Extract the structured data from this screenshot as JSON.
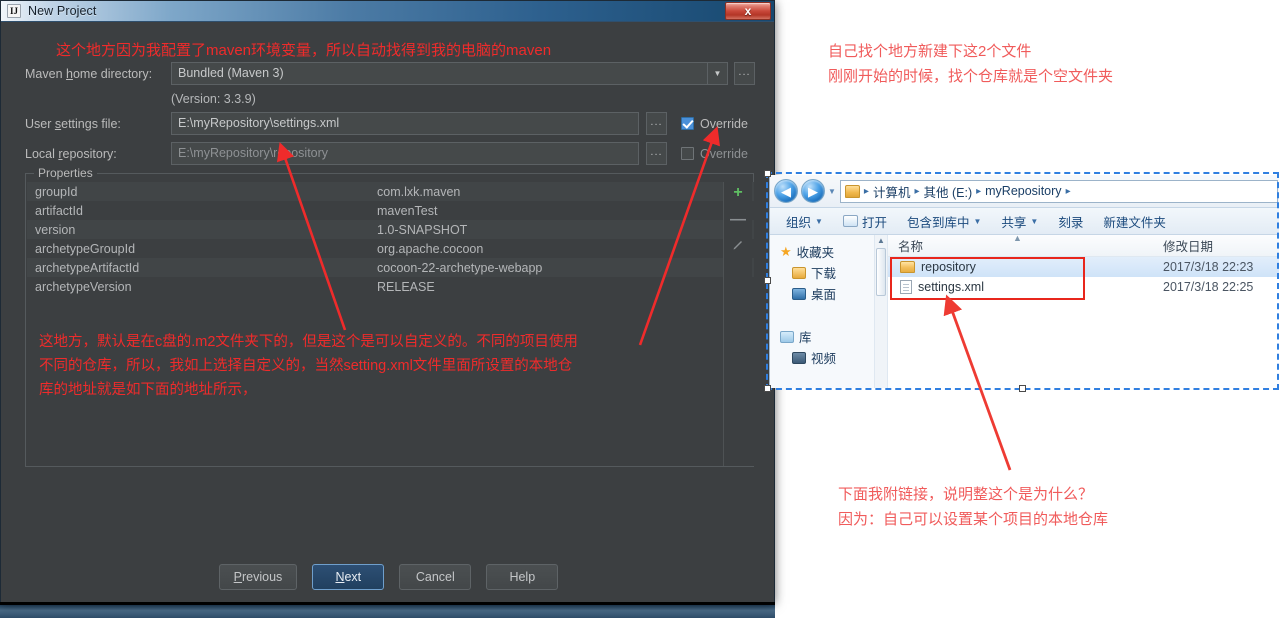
{
  "dialog": {
    "title": "New Project",
    "icon": "intellij-idea-icon",
    "close_label": "x",
    "fields": {
      "maven_home_label_pre": "Maven ",
      "maven_home_label_mnem": "h",
      "maven_home_label_post": "ome directory:",
      "maven_home_value": "Bundled (Maven 3)",
      "version_note": "(Version: 3.3.9)",
      "user_settings_label_pre": "User ",
      "user_settings_label_mnem": "s",
      "user_settings_label_post": "ettings file:",
      "user_settings_value": "E:\\myRepository\\settings.xml",
      "local_repo_label_pre": "Local ",
      "local_repo_label_mnem": "r",
      "local_repo_label_post": "epository:",
      "local_repo_value": "E:\\myRepository\\repository",
      "override_label": "Override",
      "override_settings_checked": true,
      "override_repo_checked": false,
      "browse_label": "..."
    },
    "properties": {
      "legend": "Properties",
      "rows": [
        {
          "key": "groupId",
          "value": "com.lxk.maven"
        },
        {
          "key": "artifactId",
          "value": "mavenTest"
        },
        {
          "key": "version",
          "value": "1.0-SNAPSHOT"
        },
        {
          "key": "archetypeGroupId",
          "value": "org.apache.cocoon"
        },
        {
          "key": "archetypeArtifactId",
          "value": "cocoon-22-archetype-webapp"
        },
        {
          "key": "archetypeVersion",
          "value": "RELEASE"
        }
      ],
      "actions": {
        "add": "+",
        "remove": "—",
        "edit": "edit-pencil-icon"
      }
    },
    "footer": {
      "previous_pre": "P",
      "previous_post": "revious",
      "next_pre": "N",
      "next_post": "ext",
      "cancel": "Cancel",
      "help": "Help"
    },
    "annotations": {
      "top": "这个地方因为我配置了maven环境变量，所以自动找得到我的电脑的maven",
      "middle": "这地方，默认是在c盘的.m2文件夹下的，但是这个是可以自定义的。不同的项目使用\n不同的仓库，所以，我如上选择自定义的，当然setting.xml文件里面所设置的本地仓\n库的地址就是如下面的地址所示，"
    }
  },
  "explorer": {
    "nav": {
      "back": "◀",
      "forward": "▶",
      "history_caret": "▼"
    },
    "breadcrumb": [
      "计算机",
      "其他 (E:)",
      "myRepository"
    ],
    "breadcrumb_sep": "▸",
    "toolbar": [
      {
        "label": "组织",
        "caret": true,
        "icon": null
      },
      {
        "label": "打开",
        "caret": false,
        "icon": "open-folder-icon"
      },
      {
        "label": "包含到库中",
        "caret": true,
        "icon": null
      },
      {
        "label": "共享",
        "caret": true,
        "icon": null
      },
      {
        "label": "刻录",
        "caret": false,
        "icon": null
      },
      {
        "label": "新建文件夹",
        "caret": false,
        "icon": null
      }
    ],
    "sidebar": [
      {
        "label": "收藏夹",
        "icon": "star-icon",
        "sub": false
      },
      {
        "label": "下载",
        "icon": "downloads-icon",
        "sub": true
      },
      {
        "label": "桌面",
        "icon": "desktop-icon",
        "sub": true
      },
      {
        "label": "库",
        "icon": "library-icon",
        "sub": false
      },
      {
        "label": "视频",
        "icon": "video-icon",
        "sub": true
      }
    ],
    "columns": {
      "name": "名称",
      "date": "修改日期"
    },
    "files": [
      {
        "name": "repository",
        "date": "2017/3/18 22:23",
        "type": "folder",
        "selected": true
      },
      {
        "name": "settings.xml",
        "date": "2017/3/18 22:25",
        "type": "file",
        "selected": false
      }
    ]
  },
  "page_annotations": {
    "top_right": "自己找个地方新建下这2个文件\n刚刚开始的时候，找个仓库就是个空文件夹",
    "bottom_right": "下面我附链接，说明整这个是为什么？\n因为：自己可以设置某个项目的本地仓库"
  },
  "colors": {
    "annotation_red": "#ef2b2b",
    "annotation_pink": "#f05b5b",
    "dialog_bg": "#3c3f41",
    "accent_blue": "#4a90d9",
    "selection_dashed": "#2f7fe0",
    "highlight_outline": "#e8261c",
    "add_green": "#5fbf63"
  }
}
